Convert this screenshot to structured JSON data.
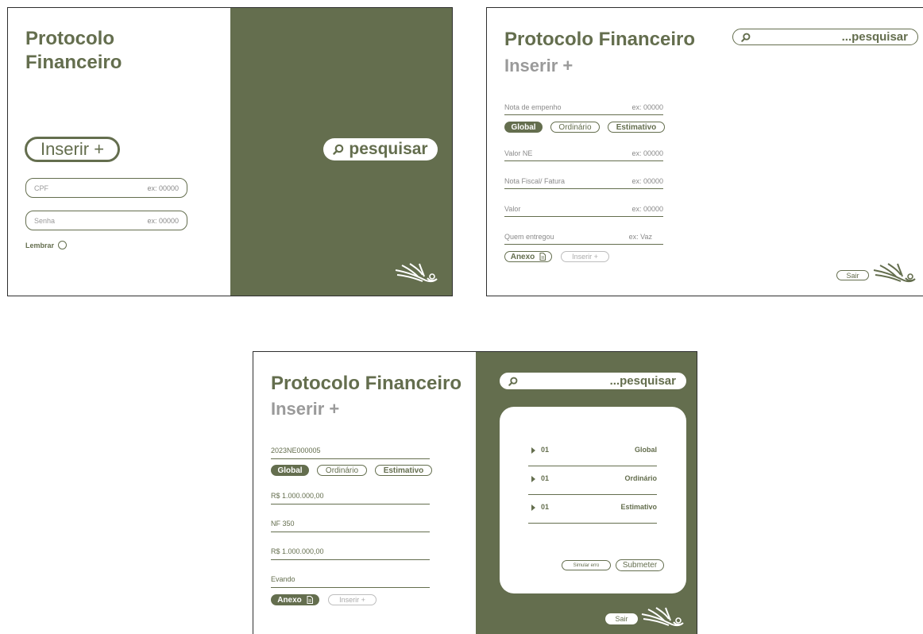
{
  "screen_login": {
    "title_line1": "Protocolo",
    "title_line2": "Financeiro",
    "insert_label": "Inserir +",
    "cpf_placeholder": "CPF",
    "cpf_example": "ex: 00000",
    "senha_placeholder": "Senha",
    "senha_example": "ex: 00000",
    "remember_label": "Lembrar",
    "search_label": "pesquisar"
  },
  "screen_form": {
    "title": "Protocolo Financeiro",
    "subtitle": "Inserir +",
    "search_label": "...pesquisar",
    "fields": [
      {
        "label": "Nota de empenho",
        "example": "ex: 00000"
      },
      {
        "label": "Valor NE",
        "example": "ex: 00000"
      },
      {
        "label": "Nota Fiscal/ Fatura",
        "example": "ex: 00000"
      },
      {
        "label": "Valor",
        "example": "ex: 00000"
      },
      {
        "label": "Quem entregou",
        "example": "ex: Vaz"
      }
    ],
    "types": [
      "Global",
      "Ordinário",
      "Estimativo"
    ],
    "active_type": "Global",
    "attach_label": "Anexo",
    "insert_label": "Inserir +",
    "exit_label": "Sair"
  },
  "screen_filled": {
    "title": "Protocolo Financeiro",
    "subtitle": "Inserir +",
    "search_label": "...pesquisar",
    "values": [
      "2023NE000005",
      "R$ 1.000.000,00",
      "NF 350",
      "R$ 1.000.000,00",
      "Evando"
    ],
    "types": [
      "Global",
      "Ordinário",
      "Estimativo"
    ],
    "active_type": "Global",
    "attach_label": "Anexo",
    "insert_label": "Inserir +",
    "results": [
      {
        "num": "01",
        "type": "Global"
      },
      {
        "num": "01",
        "type": "Ordinário"
      },
      {
        "num": "01",
        "type": "Estimativo"
      }
    ],
    "simulate_error_label": "Simular erro",
    "submit_label": "Submeter",
    "exit_label": "Sair"
  },
  "colors": {
    "brand": "#646e4e",
    "muted": "#9a9a9a"
  },
  "icons": [
    "search-icon",
    "document-icon",
    "leaf-logo-icon",
    "radio-icon",
    "triangle-right-icon"
  ]
}
